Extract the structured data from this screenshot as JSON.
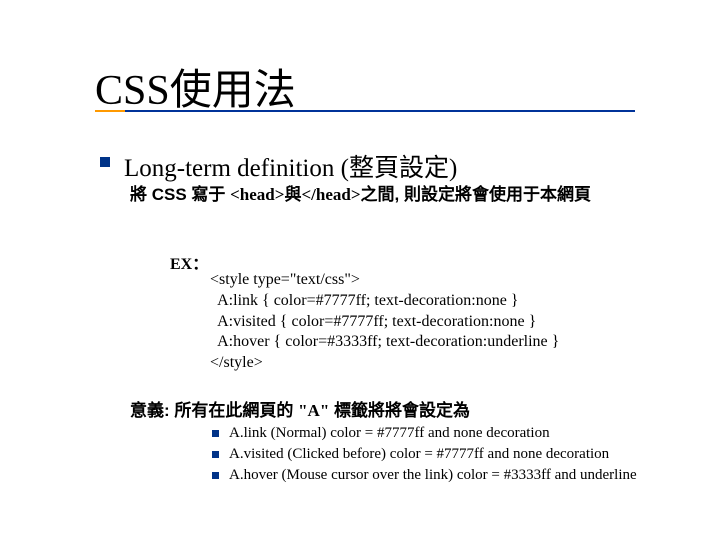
{
  "title_css": "CSS",
  "title_cjk": "使用法",
  "lvl1_en": "Long-term definition (",
  "lvl1_cjk": "整頁設定",
  "lvl1_close": ")",
  "desc_a": "將 CSS 寫于 ",
  "desc_b": "<head>與</head>",
  "desc_c": "之間, 則設定將會使用于本網頁",
  "ex_label": "EX：",
  "code_l1": "<style type=\"text/css\">",
  "code_l2": "  A:link { color=#7777ff; text-decoration:none }",
  "code_l3": "  A:visited { color=#7777ff; text-decoration:none }",
  "code_l4": "  A:hover { color=#3333ff; text-decoration:underline }",
  "code_l5": "</style>",
  "meaning_a": "意義: 所有在此網頁的 ",
  "meaning_b": "\"A\"",
  "meaning_c": " 標籤將將會設定為",
  "sub1": "A.link (Normal)  color = #7777ff and none decoration",
  "sub2": "A.visited (Clicked before) color = #7777ff and none decoration",
  "sub3": "A.hover (Mouse cursor over the link) color = #3333ff and underline"
}
